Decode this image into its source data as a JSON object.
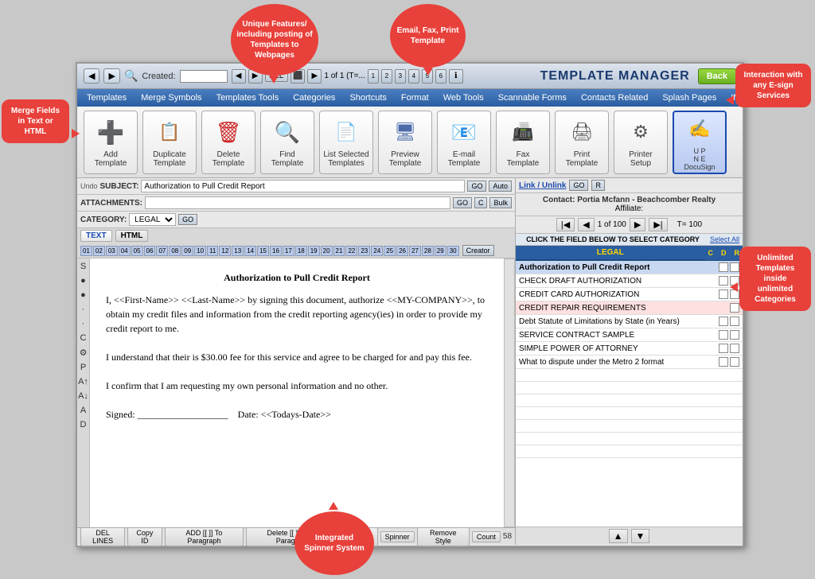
{
  "callouts": {
    "unique": "Unique Features/ including posting of Templates to Webpages",
    "email": "Email, Fax, Print Template",
    "interaction": "Interaction with any E-sign Services",
    "merge": "Merge Fields in Text or HTML",
    "unlimited": "Unlimited Templates inside unlimited Categories",
    "spinner": "Integrated Spinner System"
  },
  "titlebar": {
    "created_label": "Created:",
    "all_btn": "ALL",
    "of_label": "1 of 1 (T=...",
    "title": "TEMPLATE MANAGER",
    "back_btn": "Back"
  },
  "menu": {
    "items": [
      "Templates",
      "Merge Symbols",
      "Templates Tools",
      "Categories",
      "Shortcuts",
      "Format",
      "Web Tools",
      "Scannable Forms",
      "Contacts Related",
      "Splash Pages",
      "IMG Link Builder"
    ]
  },
  "toolbar": {
    "buttons": [
      {
        "label": "Add\nTemplate",
        "icon": "➕"
      },
      {
        "label": "Duplicate\nTemplate",
        "icon": "📋"
      },
      {
        "label": "Delete\nTemplate",
        "icon": "🗑"
      },
      {
        "label": "Find\nTemplate",
        "icon": "🔍"
      },
      {
        "label": "List Selected\nTemplates",
        "icon": "📄"
      },
      {
        "label": "Preview\nTemplate",
        "icon": "🖥"
      },
      {
        "label": "E-mail\nTemplate",
        "icon": "📧"
      },
      {
        "label": "Fax\nTemplate",
        "icon": "📠"
      },
      {
        "label": "Print\nTemplate",
        "icon": "🖨"
      },
      {
        "label": "Printer\nSetup",
        "icon": "⚙"
      },
      {
        "label": "U P\nN E\nDocuSign",
        "icon": "✍"
      }
    ]
  },
  "editor": {
    "undo_label": "Undo",
    "subject_label": "SUBJECT:",
    "subject_value": "Authorization to Pull Credit Report",
    "go_btn": "GO",
    "auto_btn": "Auto",
    "attach_label": "ATTACHMENTS:",
    "attach_go": "GO",
    "attach_c": "C",
    "attach_bulk": "Bulk",
    "category_label": "CATEGORY:",
    "category_value": "LEGAL",
    "text_tab": "TEXT",
    "html_tab": "HTML",
    "row_numbers": [
      "01",
      "02",
      "03",
      "04",
      "05",
      "06",
      "07",
      "08",
      "09",
      "10",
      "11",
      "12",
      "13",
      "14",
      "15",
      "16",
      "17",
      "18",
      "19",
      "20",
      "21",
      "22",
      "23",
      "24",
      "25",
      "26",
      "27",
      "28",
      "29",
      "30"
    ],
    "creator_btn": "Creator",
    "content_title": "Authorization to Pull Credit Report",
    "content_body": "I, <<First-Name>> <<Last-Name>> by signing this document, authorize <<MY-COMPANY>>, to obtain my credit files and information from the credit reporting agency(ies) in order to provide my credit report to me.\n\nI understand that their is $30.00 fee for this service and agree to be charged for and pay this fee.\n\nI confirm that I am requesting my own personal information and no other.\n\nSigned: ___________________    Date: <<Todays-Date>>"
  },
  "bottom_bar": {
    "buttons": [
      "DEL LINES",
      "Copy ID",
      "ADD [[ ]] To Paragraph",
      "Delete [[ ]] From Paragraph",
      "&lt;&gt; &amp;gt;>",
      "Spinner",
      "Remove Style",
      "Count",
      "58"
    ]
  },
  "right_panel": {
    "link_unlink": "Link / Unlink",
    "go_btn": "GO",
    "r_btn": "R",
    "contact_label": "Contact: Portia Mcfann - Beachcomber Realty",
    "affiliate_label": "Affiliate:",
    "nav_current": "1 of 100",
    "nav_total": "T= 100",
    "click_label": "CLICK THE FIELD BELOW TO SELECT CATEGORY",
    "select_all": "Select All",
    "category_name": "LEGAL",
    "col_c": "C",
    "col_d": "D",
    "col_r": "R",
    "templates": [
      {
        "name": "Authorization to Pull Credit Report",
        "bold": true
      },
      {
        "name": "CHECK DRAFT AUTHORIZATION",
        "bold": false
      },
      {
        "name": "CREDIT CARD AUTHORIZATION",
        "bold": false
      },
      {
        "name": "CREDIT REPAIR REQUIREMENTS",
        "bold": false
      },
      {
        "name": "Debt Statute of Limitations by State (in Years)",
        "bold": false
      },
      {
        "name": "SERVICE CONTRACT SAMPLE",
        "bold": false
      },
      {
        "name": "SIMPLE POWER OF ATTORNEY",
        "bold": false
      },
      {
        "name": "What to dispute under the Metro 2 format",
        "bold": false
      },
      {
        "name": "",
        "bold": false
      },
      {
        "name": "",
        "bold": false
      },
      {
        "name": "",
        "bold": false
      },
      {
        "name": "",
        "bold": false
      },
      {
        "name": "",
        "bold": false
      },
      {
        "name": "",
        "bold": false
      },
      {
        "name": "",
        "bold": false
      }
    ]
  }
}
